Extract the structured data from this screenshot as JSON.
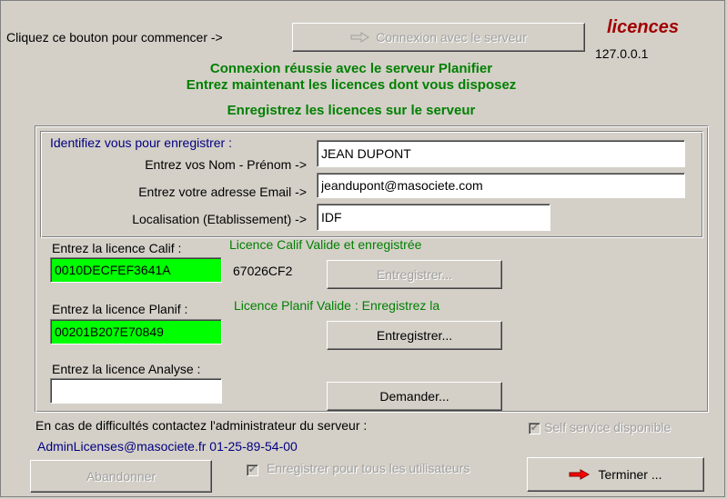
{
  "header": {
    "prompt_label": "Cliquez ce bouton pour commencer ->",
    "connect_button_label": "Connexion avec le serveur",
    "brand": "licences",
    "server_ip": "127.0.0.1",
    "status_line1": "Connexion réussie avec le serveur Planifier",
    "status_line2": "Entrez maintenant les licences dont vous disposez",
    "status_line3": "Enregistrez les licences sur le serveur"
  },
  "identity": {
    "heading": "Identifiez vous pour enregistrer :",
    "name_label": "Entrez vos Nom - Prénom ->",
    "name_value": "JEAN DUPONT",
    "email_label": "Entrez votre adresse Email ->",
    "email_value": "jeandupont@masociete.com",
    "location_label": "Localisation (Etablissement) ->",
    "location_value": "IDF"
  },
  "licenses": {
    "calif": {
      "label": "Entrez la licence Calif :",
      "status": "Licence Calif Valide et enregistrée",
      "value": "0010DECFEF3641A",
      "code": "67026CF2",
      "button_label": "Entregistrer..."
    },
    "planif": {
      "label": "Entrez la licence Planif :",
      "status": "Licence Planif Valide : Enregistrez la",
      "value": "00201B207E70849",
      "button_label": "Entregistrer..."
    },
    "analyse": {
      "label": "Entrez la licence Analyse :",
      "value": "",
      "button_label": "Demander..."
    }
  },
  "footer": {
    "contact_text": "En cas de difficultés contactez l'administrateur du serveur :",
    "contact_info": "AdminLicenses@masociete.fr 01-25-89-54-00",
    "self_service_label": "Self service disponible",
    "all_users_label": "Enregistrer pour tous les utilisateurs",
    "abandon_label": "Abandonner",
    "finish_label": "Terminer ..."
  },
  "colors": {
    "valid_field": "#00ff00",
    "status_green": "#008000",
    "link_blue": "#000080",
    "brand_red": "#a00000"
  },
  "icons": {
    "connect_arrow": "right-arrow-outline-icon",
    "finish_arrow": "red-right-arrow-icon"
  }
}
